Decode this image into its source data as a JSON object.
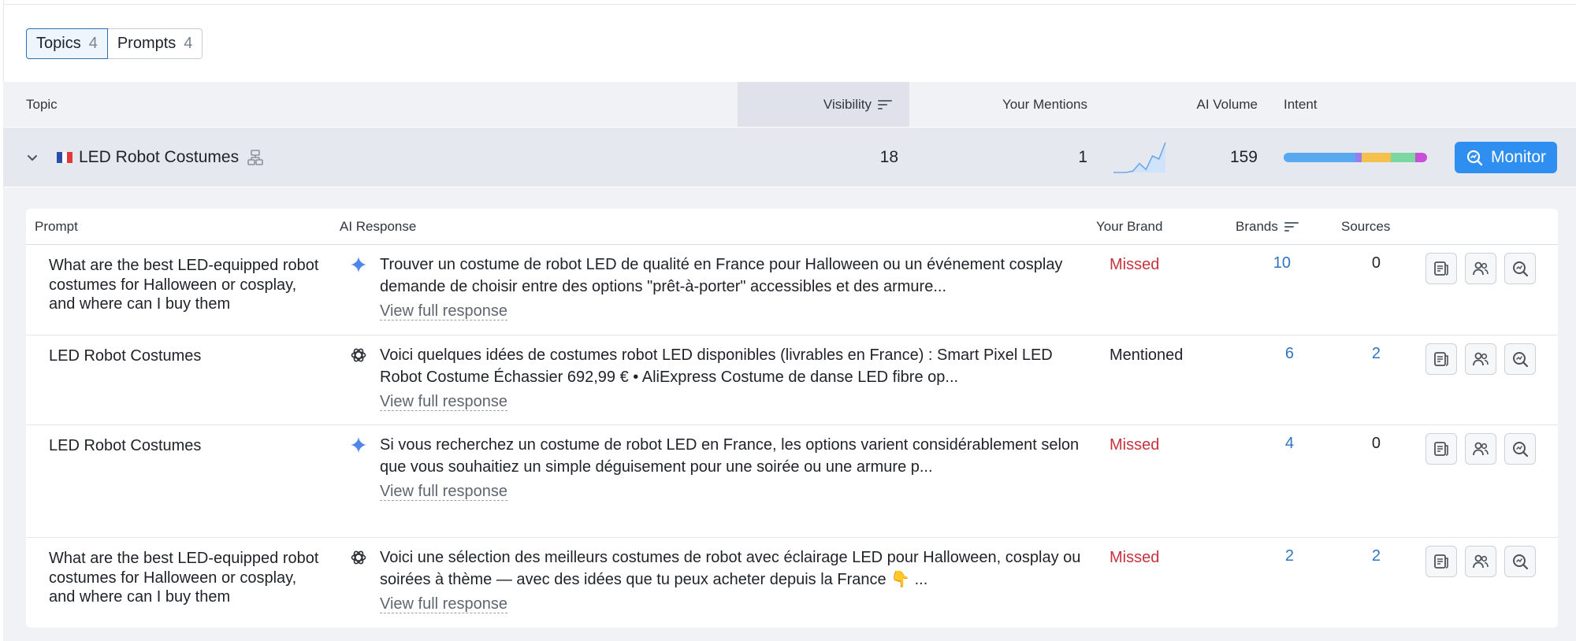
{
  "tabs": [
    {
      "label": "Topics",
      "count": "4"
    },
    {
      "label": "Prompts",
      "count": "4"
    }
  ],
  "table_header": {
    "topic": "Topic",
    "visibility": "Visibility",
    "mentions": "Your Mentions",
    "ai_volume": "AI Volume",
    "intent": "Intent"
  },
  "topic": {
    "title": "LED Robot Costumes",
    "visibility": "18",
    "mentions": "1",
    "ai_volume": "159",
    "monitor_label": "Monitor",
    "trend": [
      0,
      0,
      0,
      0.05,
      0.3,
      0.1,
      0.55,
      0.45,
      1.0
    ],
    "intent": [
      {
        "color": "#5aa9f0",
        "share": 0.55
      },
      {
        "color": "#9b7cf0",
        "share": 0.05
      },
      {
        "color": "#f4c04e",
        "share": 0.22
      },
      {
        "color": "#7cd6a0",
        "share": 0.19
      },
      {
        "color": "#c84fd8",
        "share": 0.09
      }
    ],
    "flag_colors": [
      "#2a4fa8",
      "#ffffff",
      "#e23a3a"
    ]
  },
  "panel_header": {
    "prompt": "Prompt",
    "ai_response": "AI Response",
    "your_brand": "Your Brand",
    "brands": "Brands",
    "sources": "Sources"
  },
  "rows": [
    {
      "prompt": "What are the best LED-equipped robot costumes for Halloween or cosplay, and where can I buy them",
      "engine": "gemini-icon",
      "response": "Trouver un costume de robot LED de qualité en France pour Halloween ou un événement cosplay demande de choisir entre des options \"prêt-à-porter\" accessibles et des armure...",
      "view_label": "View full response",
      "brand_status": "Missed",
      "brands": "10",
      "sources": "0"
    },
    {
      "prompt": "LED Robot Costumes",
      "engine": "openai-icon",
      "response": "Voici quelques idées de costumes robot LED disponibles (livrables en France) : Smart Pixel LED Robot Costume Échassier 692,99 € • AliExpress Costume de danse LED fibre op...",
      "view_label": "View full response",
      "brand_status": "Mentioned",
      "brands": "6",
      "sources": "2"
    },
    {
      "prompt": "LED Robot Costumes",
      "engine": "gemini-icon",
      "response": "Si vous recherchez un costume de robot LED en France, les options varient considérablement selon que vous souhaitiez un simple déguisement pour une soirée ou une armure p...",
      "view_label": "View full response",
      "brand_status": "Missed",
      "brands": "4",
      "sources": "0"
    },
    {
      "prompt": "What are the best LED-equipped robot costumes for Halloween or cosplay, and where can I buy them",
      "engine": "openai-icon",
      "response": "Voici une sélection des meilleurs costumes de robot avec éclairage LED pour Halloween, cosplay ou soirées à thème — avec des idées que tu peux acheter depuis la France 👇 ...",
      "view_label": "View full response",
      "brand_status": "Missed",
      "brands": "2",
      "sources": "2"
    }
  ]
}
